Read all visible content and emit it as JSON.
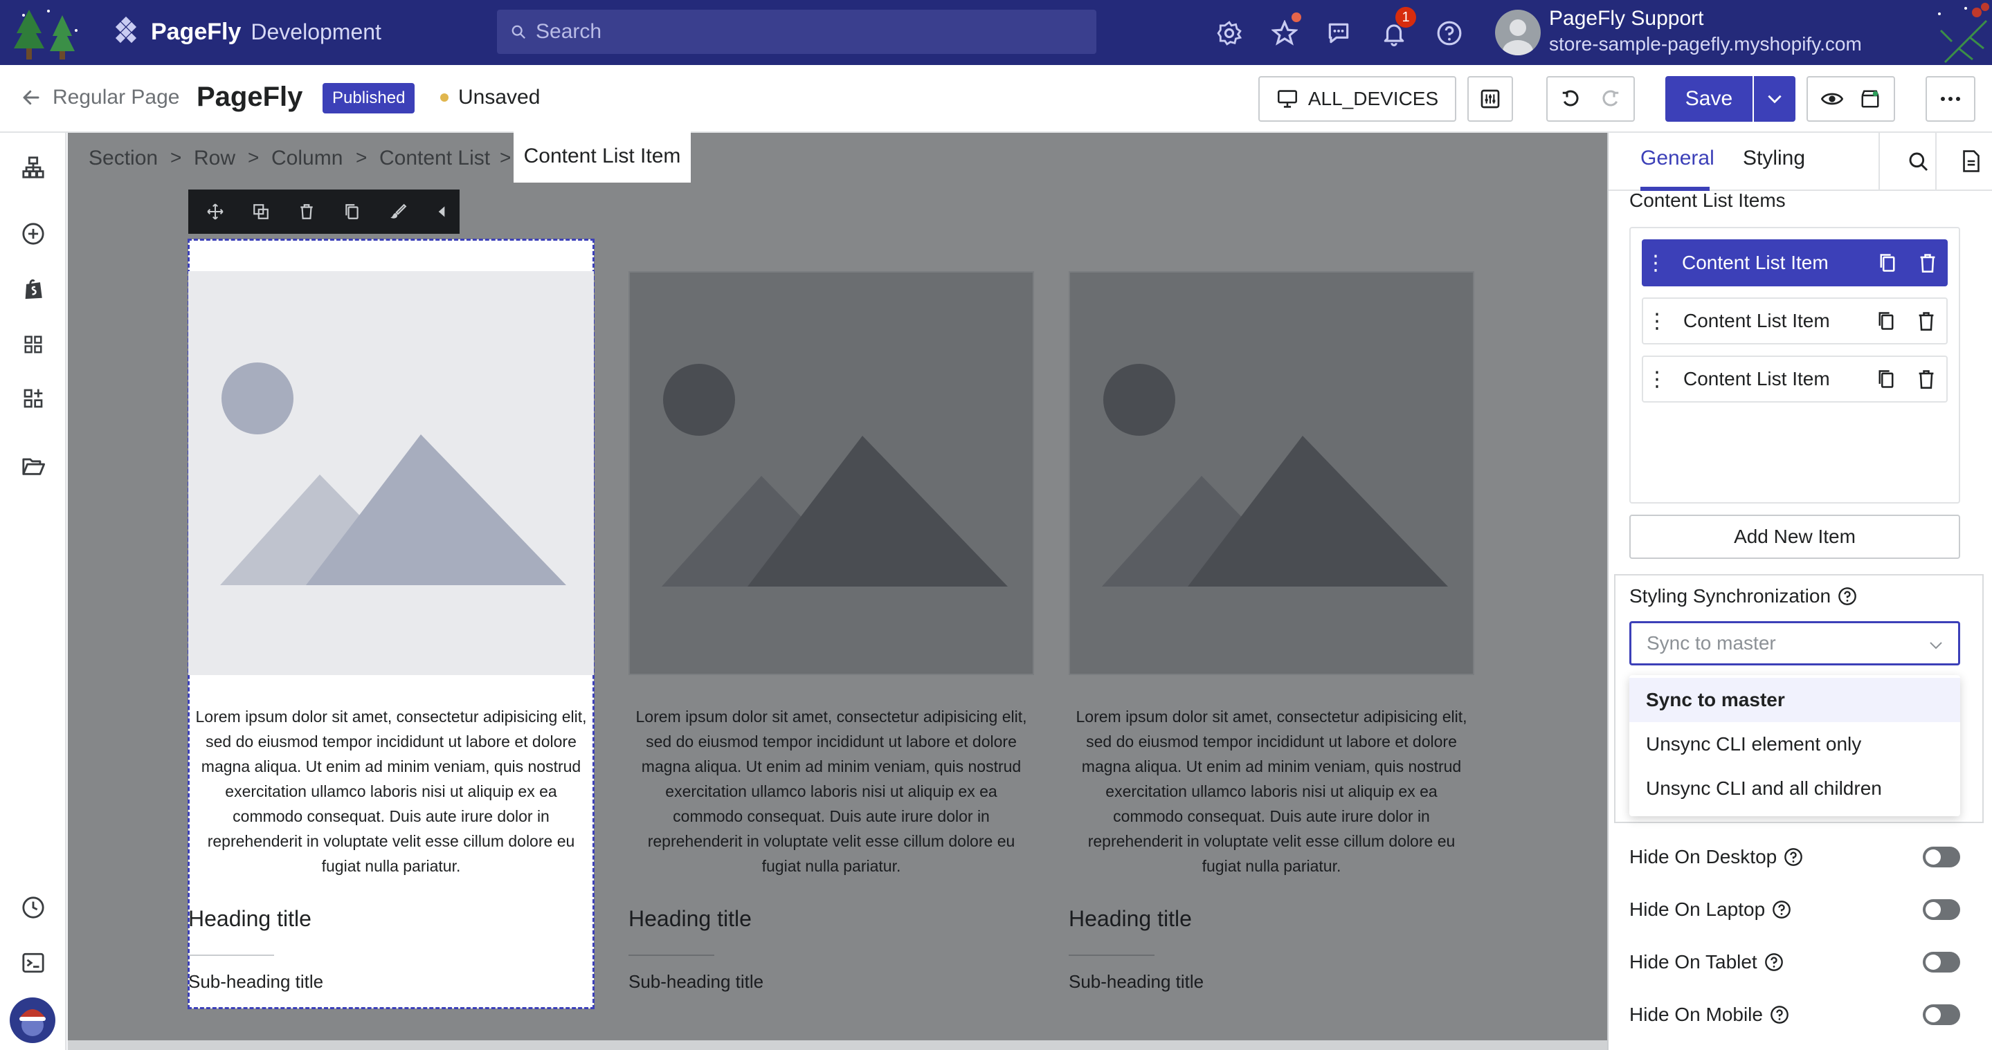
{
  "app": {
    "brand_name": "PageFly",
    "brand_env": "Development",
    "search_placeholder": "Search",
    "notification_count": "1",
    "user_name": "PageFly Support",
    "user_store": "store-sample-pagefly.myshopify.com"
  },
  "toolbar": {
    "back_label": "Regular Page",
    "page_name": "PageFly",
    "status_badge": "Published",
    "unsaved_label": "Unsaved",
    "devices_label": "ALL_DEVICES",
    "save_label": "Save"
  },
  "breadcrumb": {
    "items": [
      "Section",
      "Row",
      "Column",
      "Content List"
    ],
    "separator": ">",
    "active": "Content List Item"
  },
  "canvas": {
    "cards": [
      {
        "description": "Lorem ipsum dolor sit amet, consectetur adipisicing elit, sed do eiusmod tempor incididunt ut labore et dolore magna aliqua. Ut enim ad minim veniam, quis nostrud exercitation ullamco laboris nisi ut aliquip ex ea commodo consequat. Duis aute irure dolor in reprehenderit in voluptate velit esse cillum dolore eu fugiat nulla pariatur.",
        "heading": "Heading title",
        "subheading": "Sub-heading title"
      },
      {
        "description": "Lorem ipsum dolor sit amet, consectetur adipisicing elit, sed do eiusmod tempor incididunt ut labore et dolore magna aliqua. Ut enim ad minim veniam, quis nostrud exercitation ullamco laboris nisi ut aliquip ex ea commodo consequat. Duis aute irure dolor in reprehenderit in voluptate velit esse cillum dolore eu fugiat nulla pariatur.",
        "heading": "Heading title",
        "subheading": "Sub-heading title"
      },
      {
        "description": "Lorem ipsum dolor sit amet, consectetur adipisicing elit, sed do eiusmod tempor incididunt ut labore et dolore magna aliqua. Ut enim ad minim veniam, quis nostrud exercitation ullamco laboris nisi ut aliquip ex ea commodo consequat. Duis aute irure dolor in reprehenderit in voluptate velit esse cillum dolore eu fugiat nulla pariatur.",
        "heading": "Heading title",
        "subheading": "Sub-heading title"
      }
    ]
  },
  "panel": {
    "tabs": [
      "General",
      "Styling"
    ],
    "active_tab": "General",
    "section_title": "Content List Items",
    "list_items": [
      "Content List Item",
      "Content List Item",
      "Content List Item"
    ],
    "add_item_label": "Add New Item",
    "sync_title": "Styling Synchronization",
    "sync_placeholder": "Sync to master",
    "sync_options": [
      "Sync to master",
      "Unsync CLI element only",
      "Unsync CLI and all children"
    ],
    "hide_rows": [
      "Hide On Desktop",
      "Hide On Laptop",
      "Hide On Tablet",
      "Hide On Mobile"
    ]
  },
  "colors": {
    "topbar": "#242a7a",
    "accent": "#3c40b8",
    "canvas_bg": "#858789"
  }
}
